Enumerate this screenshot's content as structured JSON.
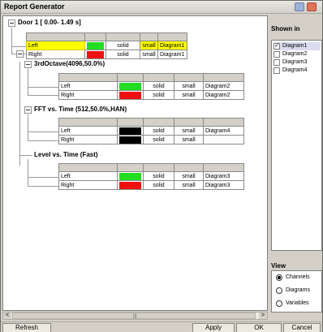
{
  "window": {
    "title": "Report Generator"
  },
  "tree": {
    "root_label": "Door 1 [ 0.00- 1.49 s]",
    "groups": [
      {
        "label": "",
        "rows": [
          {
            "name": "Left",
            "color": "#22dd22",
            "style": "solid",
            "size": "small",
            "diagram": "Diagram1",
            "selected": true
          },
          {
            "name": "Right",
            "color": "#ee1111",
            "style": "solid",
            "size": "small",
            "diagram": "Diagram1",
            "selected": false
          }
        ]
      },
      {
        "label": "3rdOctave(4096,50.0%)",
        "rows": [
          {
            "name": "Left",
            "color": "#22dd22",
            "style": "solid",
            "size": "small",
            "diagram": "Diagram2"
          },
          {
            "name": "Right",
            "color": "#ee1111",
            "style": "solid",
            "size": "small",
            "diagram": "Diagram2"
          }
        ]
      },
      {
        "label": "FFT vs. Time (512,50.0%,HAN)",
        "rows": [
          {
            "name": "Left",
            "color": "#000000",
            "style": "solid",
            "size": "small",
            "diagram": "Diagram4"
          },
          {
            "name": "Right",
            "color": "#000000",
            "style": "solid",
            "size": "small",
            "diagram": ""
          }
        ]
      },
      {
        "label": "Level vs. Time (Fast)",
        "rows": [
          {
            "name": "Left",
            "color": "#22dd22",
            "style": "solid",
            "size": "small",
            "diagram": "Diagram3"
          },
          {
            "name": "Right",
            "color": "#ee1111",
            "style": "solid",
            "size": "small",
            "diagram": "Diagram3"
          }
        ]
      }
    ]
  },
  "shown_in": {
    "title": "Shown in",
    "items": [
      {
        "label": "Diagram1",
        "checked": true
      },
      {
        "label": "Diagram2",
        "checked": false
      },
      {
        "label": "Diagram3",
        "checked": false
      },
      {
        "label": "Diagram4",
        "checked": false
      }
    ]
  },
  "view": {
    "title": "View",
    "options": [
      {
        "label": "Channels",
        "selected": true
      },
      {
        "label": "Diagrams",
        "selected": false
      },
      {
        "label": "Variables",
        "selected": false
      }
    ]
  },
  "footer": {
    "refresh": "Refresh",
    "apply": "Apply",
    "ok": "OK",
    "cancel": "Cancel"
  },
  "scroll": {
    "left_arrow": "<",
    "right_arrow": ">",
    "grip": "|||"
  },
  "check_mark": "✓"
}
